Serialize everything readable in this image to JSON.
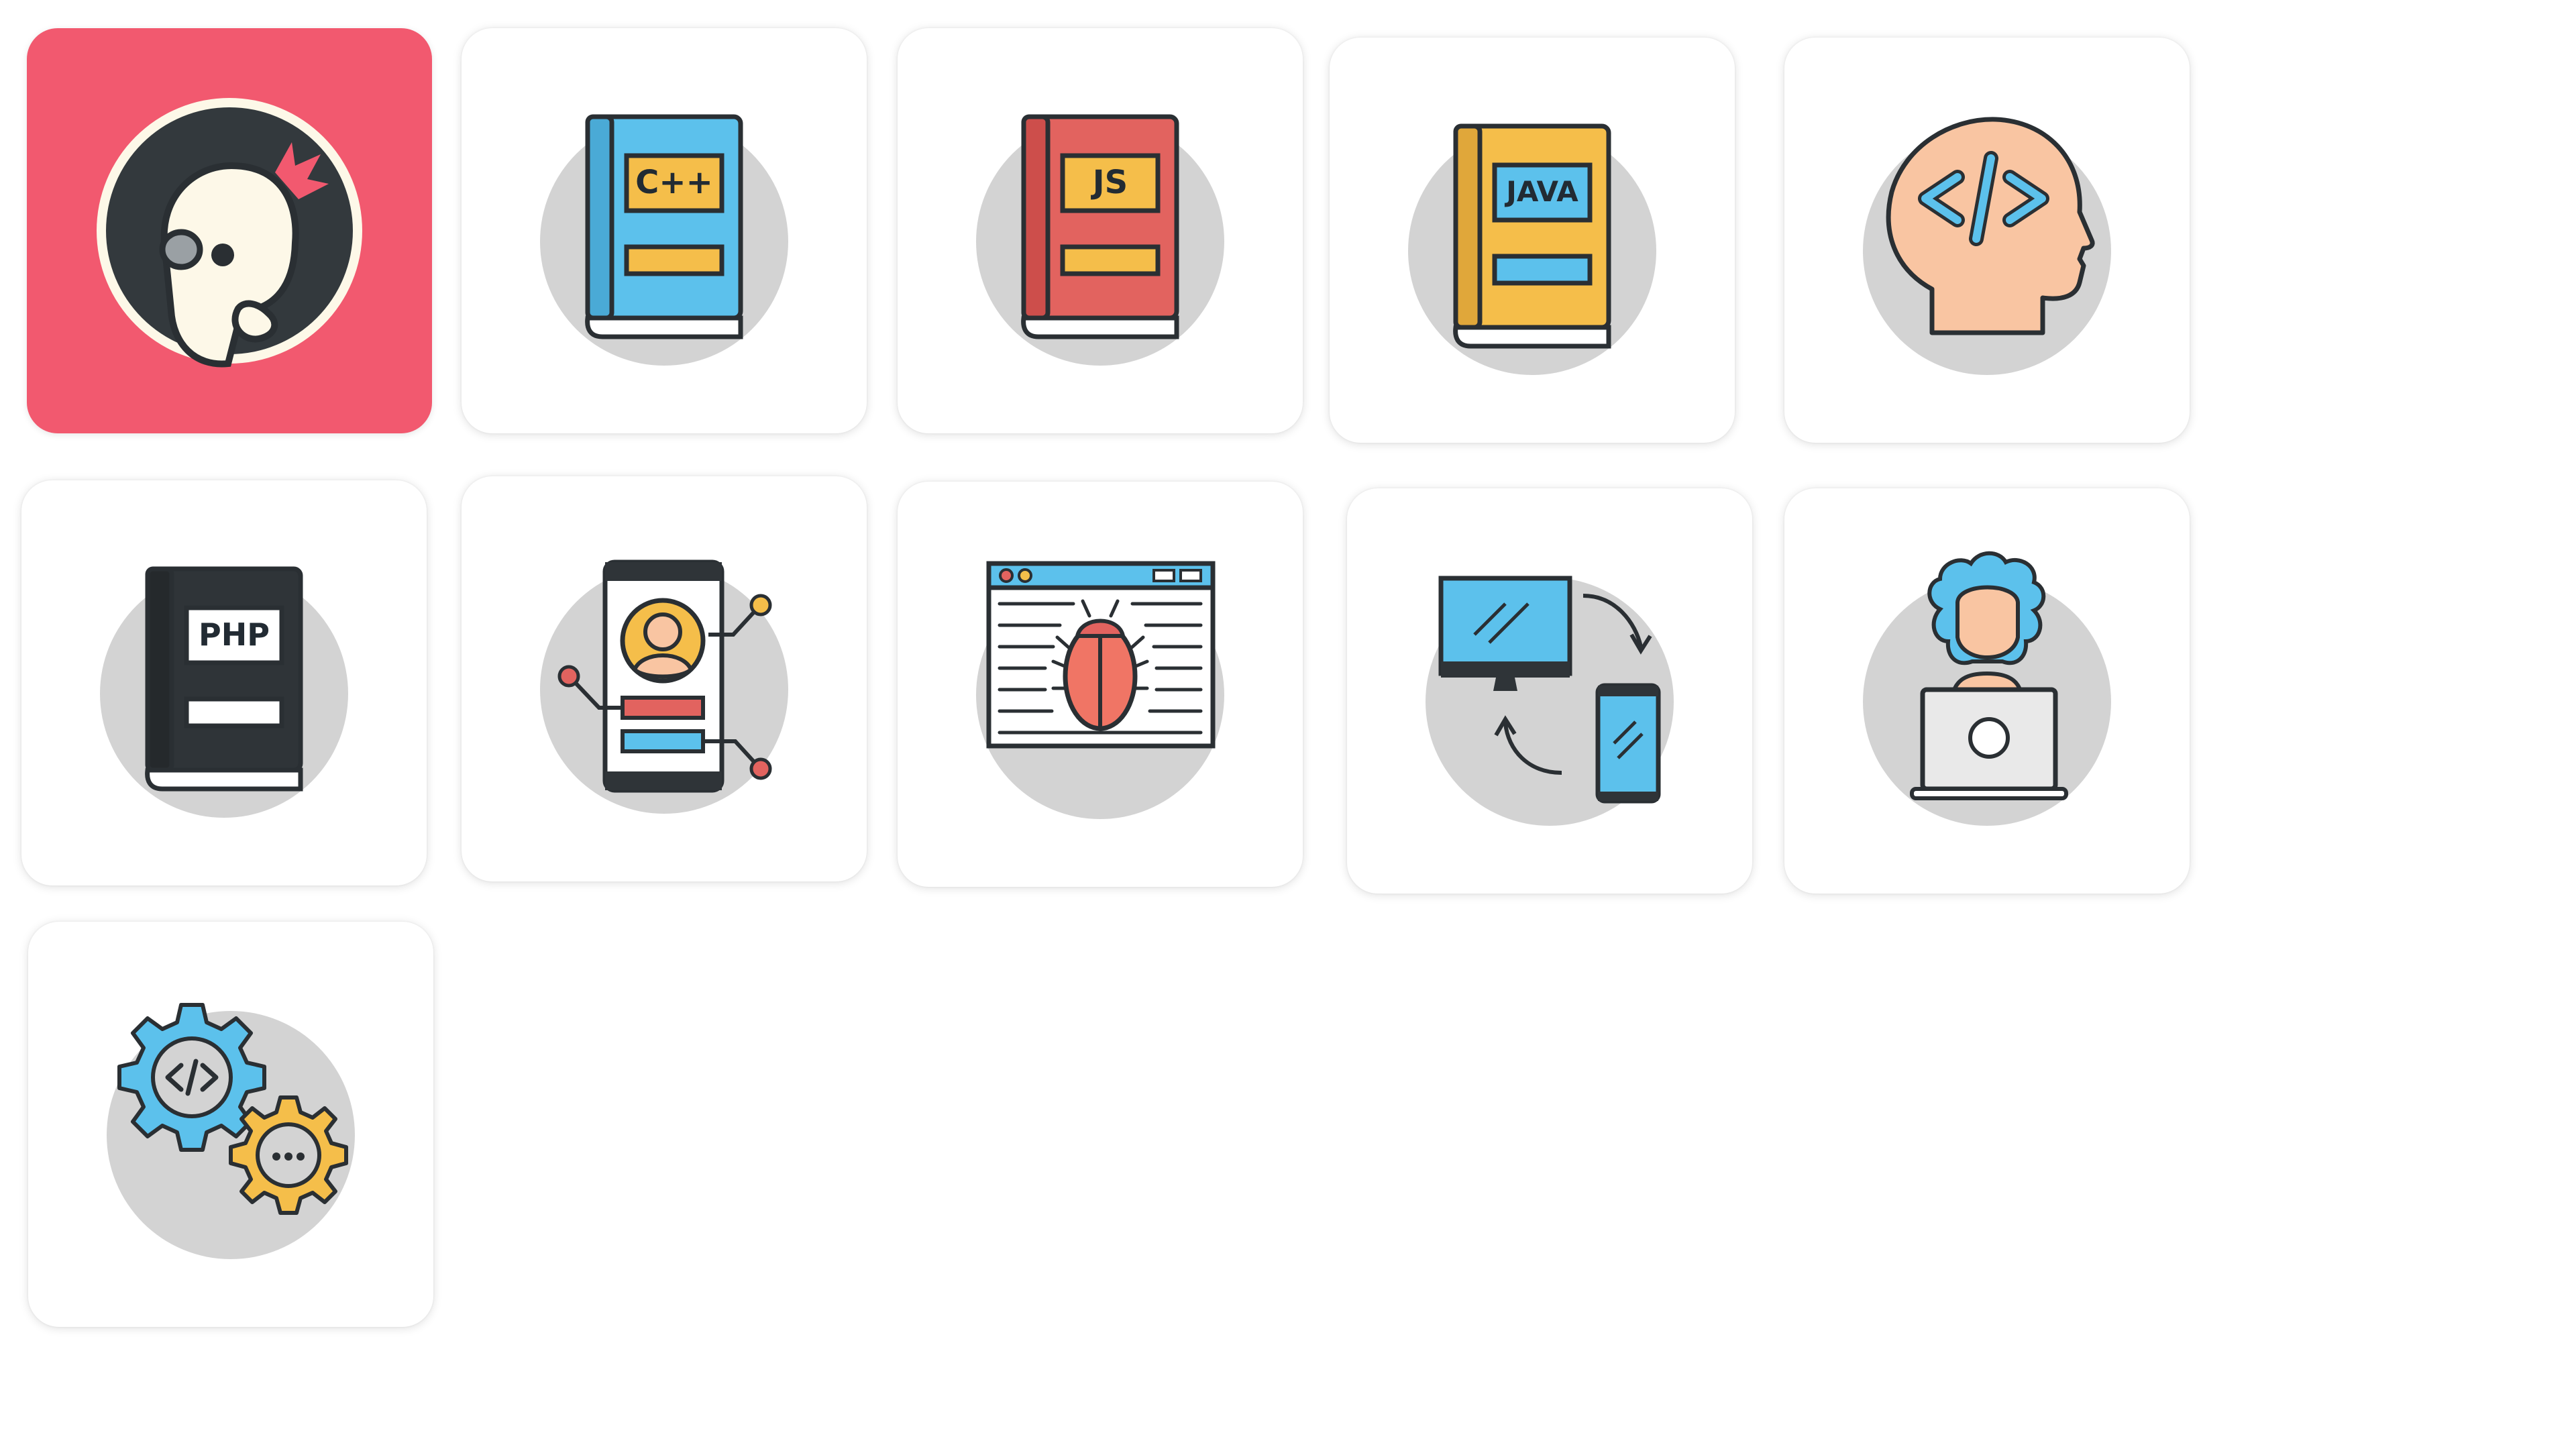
{
  "tiles": [
    {
      "name": "app-logo-tile",
      "icon": "parrot-logo-icon"
    },
    {
      "name": "cpp-book-tile",
      "icon": "cpp-book-icon",
      "label": "C++"
    },
    {
      "name": "js-book-tile",
      "icon": "js-book-icon",
      "label": "JS"
    },
    {
      "name": "java-book-tile",
      "icon": "java-book-icon",
      "label": "JAVA"
    },
    {
      "name": "coder-head-tile",
      "icon": "head-code-icon"
    },
    {
      "name": "php-book-tile",
      "icon": "php-book-icon",
      "label": "PHP"
    },
    {
      "name": "mobile-profile-tile",
      "icon": "mobile-profile-icon"
    },
    {
      "name": "browser-bug-tile",
      "icon": "browser-bug-icon"
    },
    {
      "name": "device-sync-tile",
      "icon": "device-sync-icon"
    },
    {
      "name": "developer-laptop-tile",
      "icon": "developer-laptop-icon"
    },
    {
      "name": "code-settings-tile",
      "icon": "gears-code-icon"
    }
  ],
  "colors": {
    "brand": "#f2596f",
    "blue": "#5cc1ec",
    "orange": "#f5be4a",
    "red": "#e2635f",
    "dark": "#2f3438",
    "skin": "#f9c5a2",
    "circle": "#d3d3d3",
    "tile": "#ffffff"
  }
}
